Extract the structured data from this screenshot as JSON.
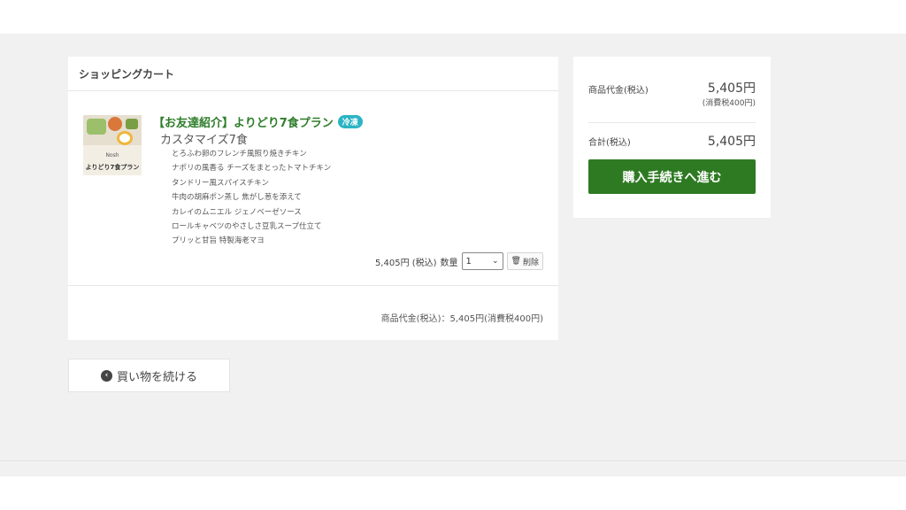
{
  "cart": {
    "header": "ショッピングカート",
    "item": {
      "title": "【お友達紹介】よりどり7食プラン",
      "badge": "冷凍",
      "subtitle": "カスタマイズ7食",
      "thumbnail": {
        "brand_text": "Nosh",
        "plan_text": "よりどり7食プラン"
      },
      "menu": [
        "とろふわ卵のフレンチ風照り焼きチキン",
        "ナポリの風香る チーズをまとったトマトチキン",
        "タンドリー風スパイスチキン",
        "牛肉の胡麻ポン蒸し 焦がし葱を添えて",
        "カレイのムニエル ジェノベーゼソース",
        "ロールキャベツのやさしさ豆乳スープ仕立て",
        "プリッと甘旨 特製海老マヨ"
      ],
      "price": "5,405円 (税込)",
      "qty_label": "数量",
      "qty_value": "1",
      "delete_label": "削除"
    },
    "subtotal": "商品代金(税込)：5,405円(消費税400円)"
  },
  "continue_label": "買い物を続ける",
  "summary": {
    "items_label": "商品代金(税込)",
    "items_amount": "5,405円",
    "items_tax": "(消費税400円)",
    "total_label": "合計(税込)",
    "total_amount": "5,405円",
    "checkout_label": "購入手続きへ進む"
  },
  "icons": {
    "trash": "trash-icon",
    "chevron": "chevron-down-icon",
    "back": "circle-chevron-left-icon"
  },
  "colors": {
    "primary_green": "#2e7a22",
    "title_green": "#2e7d2a",
    "badge_cyan": "#2bb4c4",
    "page_bg": "#f1f1f1"
  }
}
